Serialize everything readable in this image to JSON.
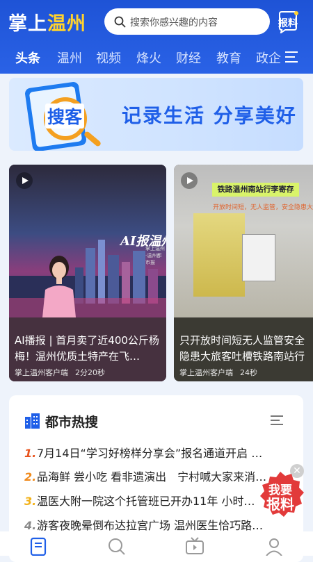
{
  "app": {
    "logo_part1": "掌上",
    "logo_part2": "温州"
  },
  "search": {
    "placeholder": "搜索你感兴趣的内容"
  },
  "header": {
    "report_label": "报料"
  },
  "tabs": [
    "头条",
    "温州",
    "视频",
    "烽火",
    "财经",
    "教育",
    "政企"
  ],
  "banner": {
    "brand": "搜客",
    "slogan": "记录生活 分享美好"
  },
  "cards": [
    {
      "title": "AI播报 | 首月卖了近400公斤杨梅！温州优质土特产在飞…",
      "source": "掌上温州客户端",
      "duration": "2分20秒",
      "overlay_logo": "AI报温州",
      "overlay_sub": "掌上温州·温州都市报"
    },
    {
      "title": "只开放时间短无人监管安全隐患大旅客吐槽铁路南站行李寄",
      "source": "掌上温州客户端",
      "duration": "24秒",
      "overlay_banner": "铁路温州南站行李寄存",
      "overlay_sub": "开放时间短，无人监管，安全隐患大"
    }
  ],
  "hot": {
    "title": "都市热搜",
    "items": [
      {
        "rank": "1.",
        "text": "7月14日“学习好榜样分享会”报名通道开启 …",
        "color": "#e8541e"
      },
      {
        "rank": "2.",
        "text": "品海鲜 尝小吃 看非遗演出　宁村喊大家来消…",
        "color": "#f08a1c"
      },
      {
        "rank": "3.",
        "text": "温医大附一院这个托管班已开办11年 小时…",
        "color": "#f3b21a"
      },
      {
        "rank": "4.",
        "text": "游客夜晚晕倒布达拉宫广场 温州医生恰巧路…",
        "color": "#888888"
      }
    ]
  },
  "float_badge": {
    "text": "我要报料"
  },
  "colors": {
    "header_blue": "#1e53d6",
    "accent_yellow": "#ffd22e",
    "badge_red": "#e23a3a"
  }
}
